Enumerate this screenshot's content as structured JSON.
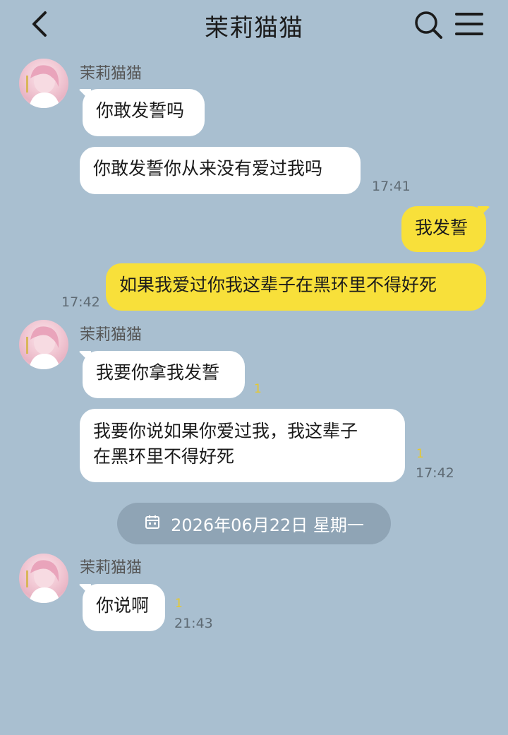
{
  "header": {
    "title": "茉莉猫猫",
    "back_icon": "chevron-left-icon",
    "search_icon": "search-icon",
    "menu_icon": "menu-icon"
  },
  "colors": {
    "background": "#a9bfd0",
    "incoming_bubble": "#ffffff",
    "outgoing_bubble": "#f8e03a",
    "date_pill": "#8fa4b5"
  },
  "messages": {
    "group1": {
      "sender": "茉莉猫猫",
      "m1": "你敢发誓吗",
      "m2": "你敢发誓你从来没有爱过我吗",
      "time": "17:41"
    },
    "outgoing": {
      "m1": "我发誓",
      "m2": "如果我爱过你我这辈子在黑环里不得好死",
      "time": "17:42"
    },
    "group2": {
      "sender": "茉莉猫猫",
      "m1": "我要你拿我发誓",
      "m1_read": "1",
      "m2_line1": "我要你说如果你爱过我，我这辈子",
      "m2_line2": "在黑环里不得好死",
      "m2_read": "1",
      "time": "17:42"
    },
    "date_divider": {
      "text": "2026年06月22日 星期一",
      "icon": "calendar-icon"
    },
    "group3": {
      "sender": "茉莉猫猫",
      "m1": "你说啊",
      "m1_read": "1",
      "time": "21:43"
    }
  }
}
